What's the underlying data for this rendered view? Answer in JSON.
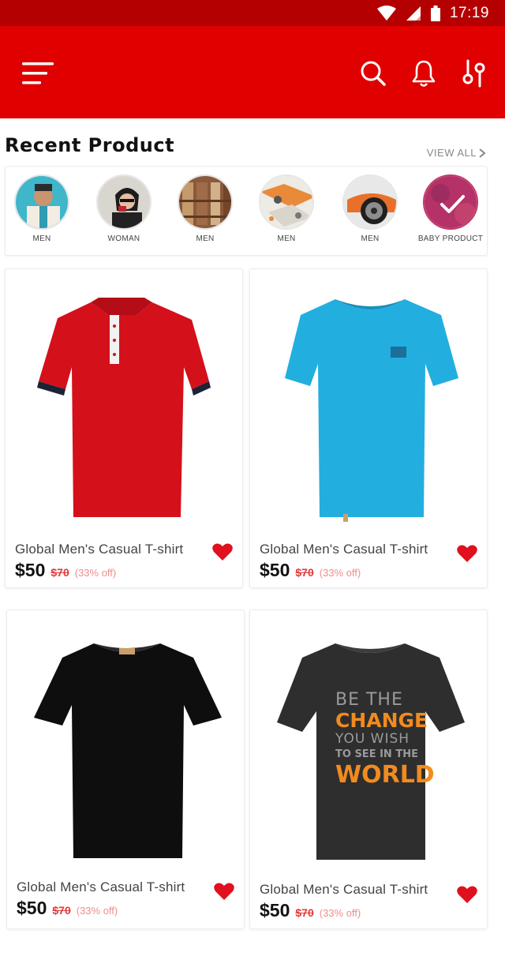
{
  "status_bar": {
    "time": "17:19"
  },
  "app_bar": {
    "menu_icon": "hamburger-menu-icon",
    "actions": [
      "search-icon",
      "bell-icon",
      "filter-icon"
    ]
  },
  "section": {
    "title": "Recent Product",
    "view_all": "VIEW ALL"
  },
  "categories": [
    {
      "label": "MEN"
    },
    {
      "label": "WOMAN"
    },
    {
      "label": "MEN"
    },
    {
      "label": "MEN"
    },
    {
      "label": "MEN"
    },
    {
      "label": "BABY PRODUCT"
    }
  ],
  "products": [
    {
      "title": "Global Men's Casual T-shirt",
      "price": "$50",
      "old_price": "$70",
      "discount": "(33% off)",
      "shirt_color": "#d4101b"
    },
    {
      "title": "Global Men's Casual T-shirt",
      "price": "$50",
      "old_price": "$70",
      "discount": "(33% off)",
      "shirt_color": "#23aee0"
    },
    {
      "title": "Global Men's Casual T-shirt",
      "price": "$50",
      "old_price": "$70",
      "discount": "(33% off)",
      "shirt_color": "#0e0e0e"
    },
    {
      "title": "Global Men's Casual T-shirt",
      "price": "$50",
      "old_price": "$70",
      "discount": "(33% off)",
      "shirt_color": "#2e2e2e",
      "print_lines": [
        "BE THE",
        "CHANGE",
        "YOU WISH",
        "TO SEE IN THE",
        "WORLD"
      ]
    }
  ],
  "colors": {
    "status_bar": "#b40000",
    "app_bar": "#e00000",
    "heart": "#e0101f",
    "old_price": "#e23a3a",
    "discount": "#f08c8c"
  }
}
